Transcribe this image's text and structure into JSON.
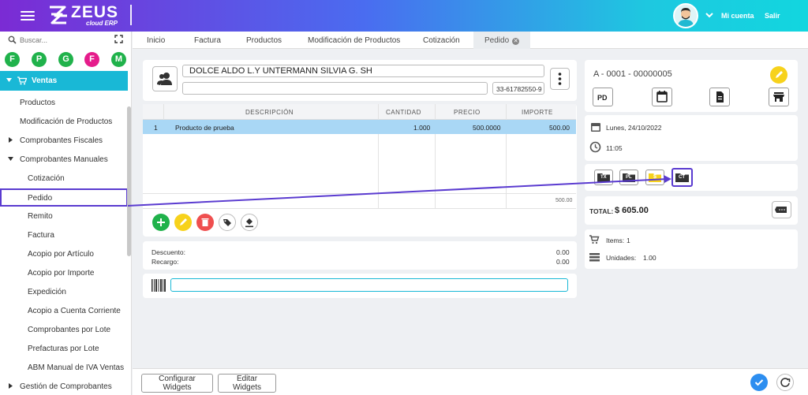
{
  "header": {
    "brand": "ZEUS",
    "brand_sub": "cloud ERP",
    "account_label": "Mi cuenta",
    "logout_label": "Salir"
  },
  "sidebar": {
    "search_placeholder": "Buscar...",
    "favorites": [
      {
        "letter": "F",
        "color": "#20b24b"
      },
      {
        "letter": "P",
        "color": "#20b24b"
      },
      {
        "letter": "G",
        "color": "#20b24b"
      },
      {
        "letter": "F",
        "color": "#e51c8b"
      },
      {
        "letter": "M",
        "color": "#20b24b"
      }
    ],
    "section": "Ventas",
    "items": [
      {
        "label": "Productos"
      },
      {
        "label": "Modificación de Productos"
      },
      {
        "label": "Comprobantes Fiscales"
      },
      {
        "label": "Comprobantes Manuales"
      },
      {
        "label": "Cotización"
      },
      {
        "label": "Pedido"
      },
      {
        "label": "Remito"
      },
      {
        "label": "Factura"
      },
      {
        "label": "Acopio por Artículo"
      },
      {
        "label": "Acopio por Importe"
      },
      {
        "label": "Expedición"
      },
      {
        "label": "Acopio a Cuenta Corriente"
      },
      {
        "label": "Comprobantes por Lote"
      },
      {
        "label": "Prefacturas por Lote"
      },
      {
        "label": "ABM Manual de IVA Ventas"
      },
      {
        "label": "Gestión de Comprobantes"
      }
    ]
  },
  "tabs": [
    {
      "label": "Inicio"
    },
    {
      "label": "Factura"
    },
    {
      "label": "Productos"
    },
    {
      "label": "Modificación de Productos"
    },
    {
      "label": "Cotización"
    },
    {
      "label": "Pedido"
    }
  ],
  "client": {
    "name": "DOLCE ALDO L.Y UNTERMANN SILVIA G. SH",
    "secondary": "",
    "cuit": "33-61782550-9"
  },
  "items_table": {
    "columns": [
      "DESCRIPCIÓN",
      "CANTIDAD",
      "PRECIO",
      "IMPORTE"
    ],
    "rows": [
      {
        "num": "1",
        "description": "Producto de prueba",
        "quantity": "1.000",
        "price": "500.0000",
        "amount": "500.00"
      }
    ],
    "footer_total": "500.00"
  },
  "adjustments": {
    "discount_label": "Descuento:",
    "discount_value": "0.00",
    "surcharge_label": "Recargo:",
    "surcharge_value": "0.00"
  },
  "barcode_input": {
    "value": ""
  },
  "doc": {
    "number": "A - 0001 - 00000005",
    "type_code": "PD",
    "date": "Lunes, 24/10/2022",
    "time": "11:05",
    "mini_buttons": [
      "TX",
      "PL",
      "$",
      "CT"
    ]
  },
  "totals": {
    "total_label": "TOTAL:",
    "total_value": "$ 605.00",
    "items_label": "Items:",
    "items_value": "1",
    "units_label": "Unidades:",
    "units_value": "1.00"
  },
  "footer": {
    "configure_label": "Configurar Widgets",
    "edit_label": "Editar Widgets"
  },
  "colors": {
    "accent": "#19b8d6",
    "selected_row": "#a9d7f5",
    "annotation": "#5a3bd0",
    "green": "#20b24b",
    "yellow": "#f7d21c",
    "red": "#ef4f4f",
    "confirm_blue": "#2d8ef0"
  }
}
